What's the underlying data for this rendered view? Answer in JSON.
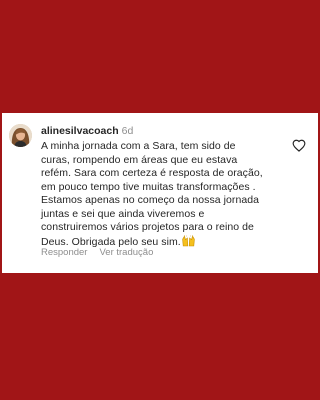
{
  "comment": {
    "username": "alinesilvacoach",
    "time": "6d",
    "text_lines": [
      "A minha jornada com a Sara, tem sido de",
      "curas, rompendo em áreas que eu estava",
      "refém. Sara com certeza é resposta de oração,",
      "em pouco tempo tive muitas transformações .",
      "Estamos apenas no começo da nossa jornada",
      "juntas e sei que ainda viveremos e",
      "construiremos vários projetos para o reino de",
      "Deus. Obrigada pelo seu sim."
    ],
    "emoji": "raising-hands-emoji",
    "reply_label": "Responder",
    "translation_label": "Ver tradução",
    "like_icon": "heart-outline-icon"
  },
  "colors": {
    "background": "#a11517",
    "card": "#ffffff",
    "text": "#262626",
    "secondary": "#8e8e8e",
    "emoji": "#f5c01e"
  }
}
